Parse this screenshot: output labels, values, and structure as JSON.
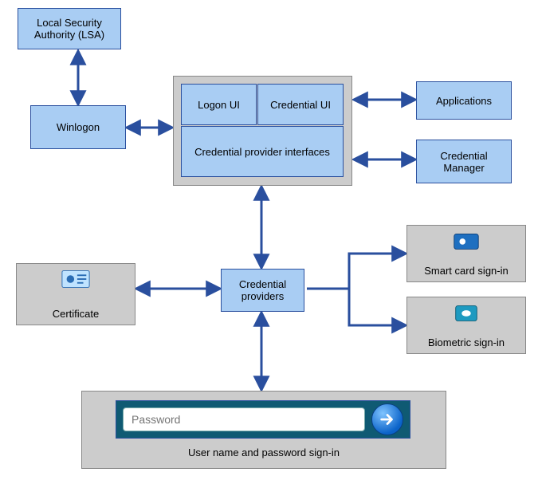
{
  "boxes": {
    "lsa": "Local Security Authority (LSA)",
    "winlogon": "Winlogon",
    "logon_ui": "Logon UI",
    "credential_ui": "Credential UI",
    "cp_interfaces": "Credential provider interfaces",
    "applications": "Applications",
    "cred_manager": "Credential Manager",
    "certificate": "Certificate",
    "credential_providers": "Credential providers",
    "smartcard": "Smart card sign-in",
    "biometric": "Biometric sign-in",
    "userpass": "User name and password sign-in"
  },
  "password_field": {
    "placeholder": "Password",
    "value": ""
  }
}
